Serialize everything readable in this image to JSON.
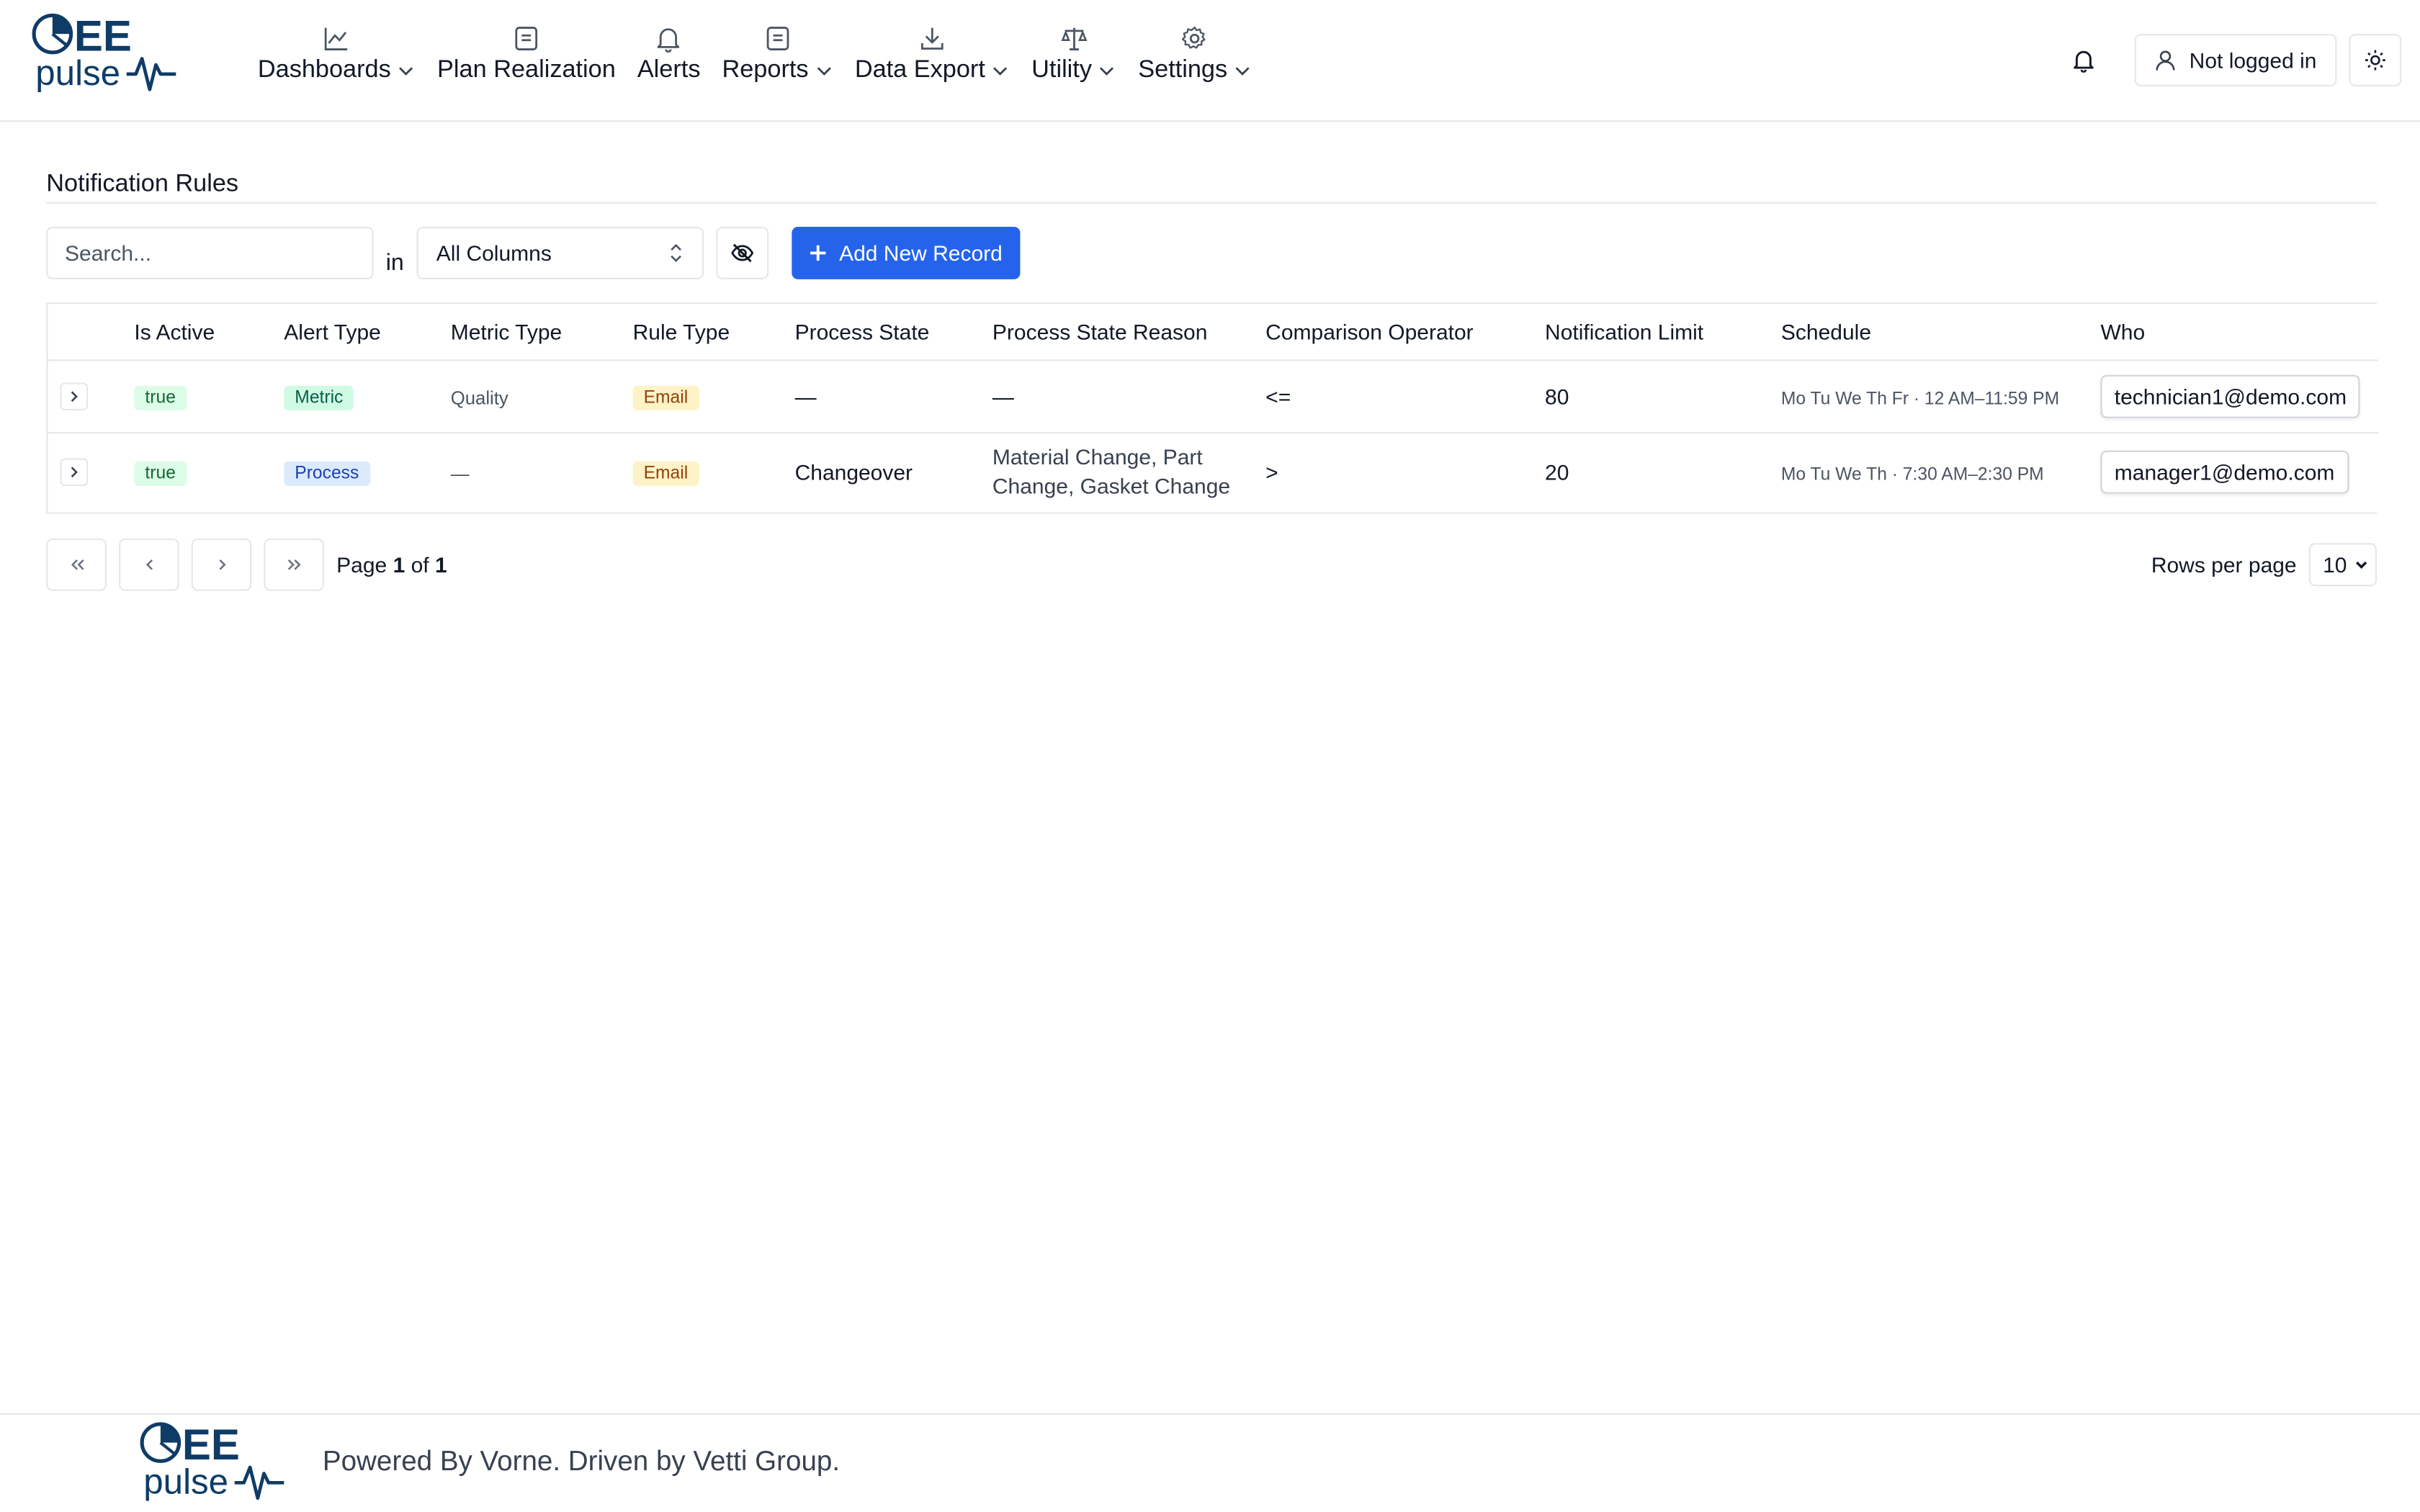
{
  "brand": {
    "logo_top": "EE",
    "logo_bottom": "pulse",
    "color": "#0f3c67"
  },
  "nav": [
    {
      "label": "Dashboards",
      "icon": "line-chart-icon",
      "has_dropdown": true
    },
    {
      "label": "Plan Realization",
      "icon": "document-icon",
      "has_dropdown": false
    },
    {
      "label": "Alerts",
      "icon": "bell-icon",
      "has_dropdown": false
    },
    {
      "label": "Reports",
      "icon": "document-icon",
      "has_dropdown": true
    },
    {
      "label": "Data Export",
      "icon": "download-icon",
      "has_dropdown": true
    },
    {
      "label": "Utility",
      "icon": "scale-icon",
      "has_dropdown": true
    },
    {
      "label": "Settings",
      "icon": "gear-icon",
      "has_dropdown": true
    }
  ],
  "header_right": {
    "login_label": "Not logged in"
  },
  "page": {
    "title": "Notification Rules"
  },
  "toolbar": {
    "search_placeholder": "Search...",
    "in_label": "in",
    "column_select": "All Columns",
    "add_label": "Add New Record",
    "accent": "#2563eb"
  },
  "table": {
    "columns": [
      "Is Active",
      "Alert Type",
      "Metric Type",
      "Rule Type",
      "Process State",
      "Process State Reason",
      "Comparison Operator",
      "Notification Limit",
      "Schedule",
      "Who"
    ],
    "rows": [
      {
        "is_active": "true",
        "alert_type": "Metric",
        "metric_type": "Quality",
        "rule_type": "Email",
        "process_state": "—",
        "process_state_reason": "—",
        "comparison_operator": "<=",
        "notification_limit": "80",
        "schedule": "Mo Tu We Th Fr · 12 AM–11:59 PM",
        "who": "technician1@demo.com"
      },
      {
        "is_active": "true",
        "alert_type": "Process",
        "metric_type": "—",
        "rule_type": "Email",
        "process_state": "Changeover",
        "process_state_reason": "Material Change, Part Change, Gasket Change",
        "comparison_operator": ">",
        "notification_limit": "20",
        "schedule": "Mo Tu We Th · 7:30 AM–2:30 PM",
        "who": "manager1@demo.com"
      }
    ]
  },
  "pagination": {
    "page_label": "Page",
    "current": "1",
    "of_label": "of",
    "total": "1",
    "rows_per_page_label": "Rows per page",
    "rows_per_page": "10"
  },
  "footer": {
    "text": "Powered By Vorne. Driven by Vetti Group."
  }
}
